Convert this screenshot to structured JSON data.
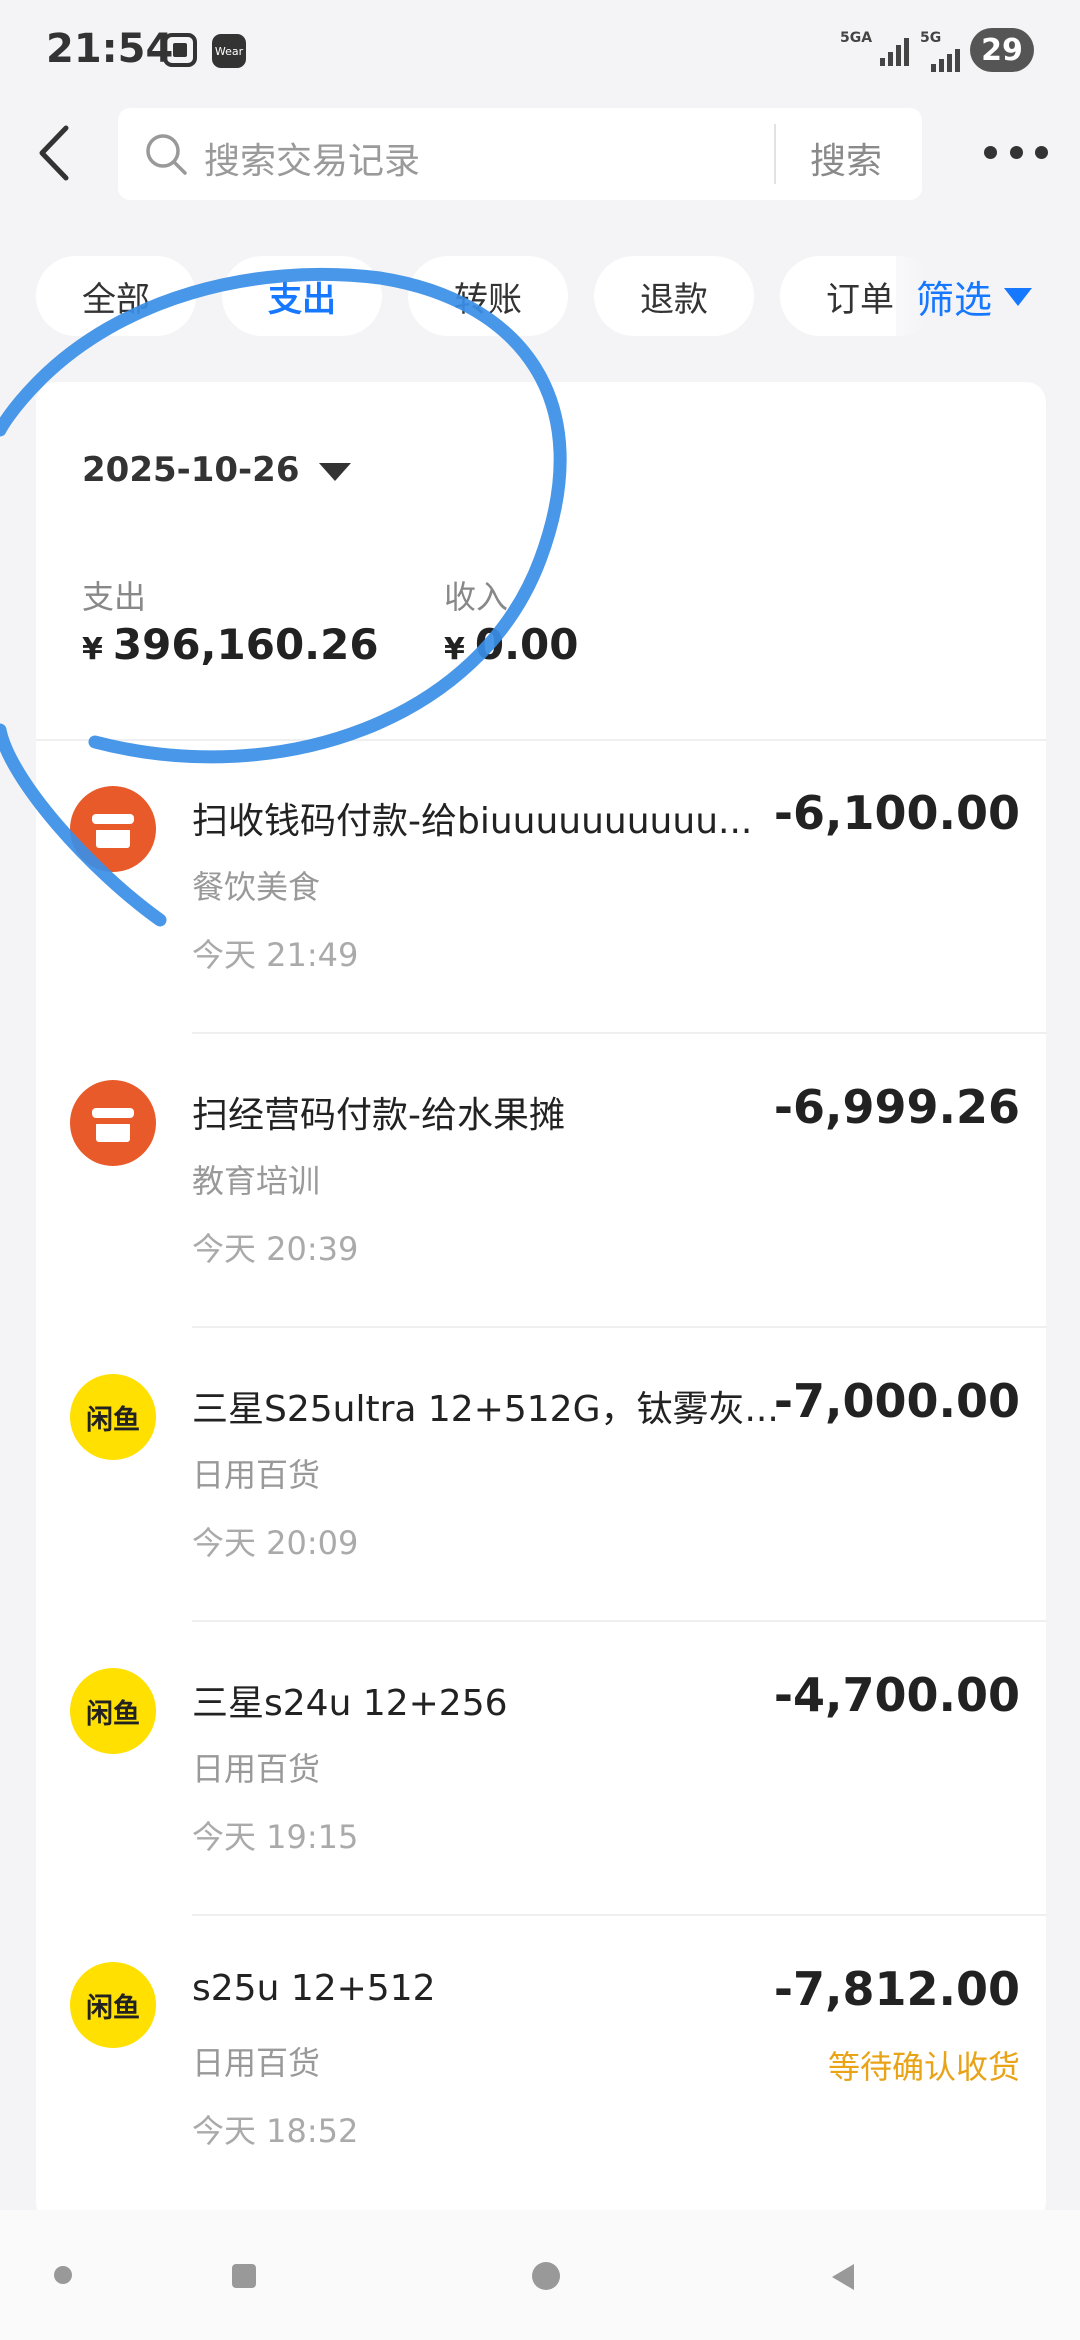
{
  "status_bar": {
    "time": "21:54",
    "wear_badge": "Wear",
    "signal1": "5GA",
    "signal2": "5G",
    "battery": "29"
  },
  "header": {
    "search_placeholder": "搜索交易记录",
    "search_button": "搜索"
  },
  "tabs": [
    {
      "label": "全部",
      "active": false
    },
    {
      "label": "支出",
      "active": true
    },
    {
      "label": "转账",
      "active": false
    },
    {
      "label": "退款",
      "active": false
    },
    {
      "label": "订单",
      "active": false
    }
  ],
  "filter_label": "筛选",
  "summary": {
    "date": "2025-10-26",
    "expense_label": "支出",
    "expense_currency": "¥",
    "expense_value": "396,160.26",
    "income_label": "收入",
    "income_currency": "¥",
    "income_value": "0.00"
  },
  "transactions": [
    {
      "title": "扫收钱码付款-给biuuuuuuuuuu...",
      "category": "餐饮美食",
      "time": "今天 21:49",
      "amount": "-6,100.00",
      "status": "",
      "icon": "shop-icon"
    },
    {
      "title": "扫经营码付款-给水果摊",
      "category": "教育培训",
      "time": "今天 20:39",
      "amount": "-6,999.26",
      "status": "",
      "icon": "shop-icon"
    },
    {
      "title": "三星S25ultra 12+512G，钛雾灰...",
      "category": "日用百货",
      "time": "今天 20:09",
      "amount": "-7,000.00",
      "status": "",
      "icon": "xianyu-icon"
    },
    {
      "title": "三星s24u 12+256",
      "category": "日用百货",
      "time": "今天 19:15",
      "amount": "-4,700.00",
      "status": "",
      "icon": "xianyu-icon"
    },
    {
      "title": "s25u 12+512",
      "category": "日用百货",
      "time": "今天 18:52",
      "amount": "-7,812.00",
      "status": "等待确认收货",
      "icon": "xianyu-icon"
    }
  ],
  "xianyu_logo_text": "闲鱼",
  "colors": {
    "accent": "#1677ff",
    "shop_icon": "#e85a2a",
    "xianyu_icon": "#ffe000",
    "pending_status": "#e8a317",
    "scribble": "#3a8ee6"
  }
}
